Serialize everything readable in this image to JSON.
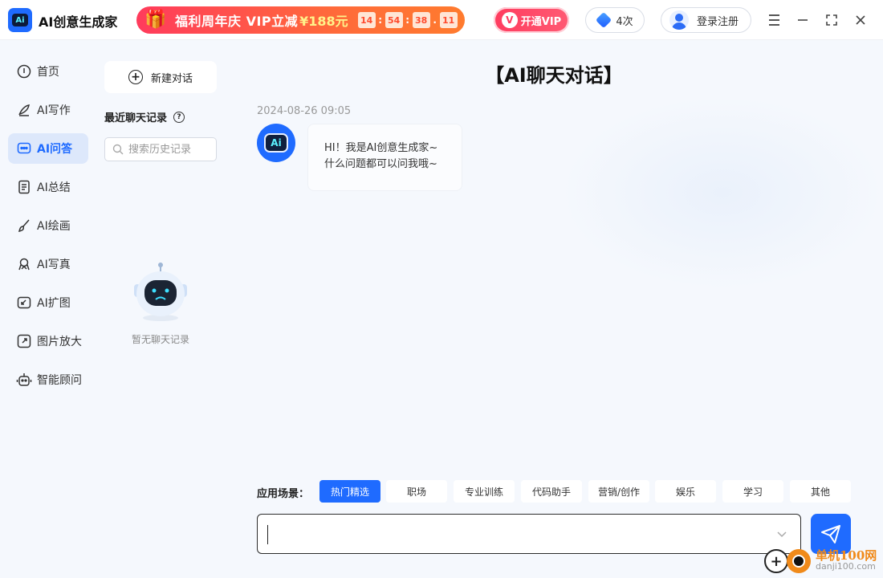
{
  "app": {
    "name": "AI创意生成家",
    "logo_text": "Ai"
  },
  "promo": {
    "text": "福利周年庆  VIP立减",
    "price": "¥188元",
    "countdown": [
      "14",
      "54",
      "38",
      "11"
    ]
  },
  "header": {
    "vip_label": "开通VIP",
    "count_label": "4次",
    "login_label": "登录注册"
  },
  "nav": {
    "items": [
      {
        "label": "首页",
        "icon": "home-icon"
      },
      {
        "label": "AI写作",
        "icon": "pen-icon"
      },
      {
        "label": "AI问答",
        "icon": "chat-icon"
      },
      {
        "label": "AI总结",
        "icon": "document-icon"
      },
      {
        "label": "AI绘画",
        "icon": "brush-icon"
      },
      {
        "label": "AI写真",
        "icon": "portrait-icon"
      },
      {
        "label": "AI扩图",
        "icon": "expand-image-icon"
      },
      {
        "label": "图片放大",
        "icon": "zoom-image-icon"
      },
      {
        "label": "智能顾问",
        "icon": "robot-icon"
      }
    ],
    "active_index": 2
  },
  "history": {
    "new_chat_label": "新建对话",
    "recent_title": "最近聊天记录",
    "search_placeholder": "搜索历史记录",
    "empty_text": "暂无聊天记录"
  },
  "chat": {
    "title": "【AI聊天对话】",
    "timestamp": "2024-08-26 09:05",
    "bot_avatar_text": "Ai",
    "message_line1": "HI！我是AI创意生成家~",
    "message_line2": "什么问题都可以问我哦~"
  },
  "scenes": {
    "label": "应用场景：",
    "tabs": [
      "热门精选",
      "职场",
      "专业训练",
      "代码助手",
      "营销/创作",
      "娱乐",
      "学习",
      "其他"
    ],
    "active_index": 0
  },
  "input": {
    "value": "",
    "placeholder": ""
  },
  "watermark": {
    "cn": "单机100网",
    "en": "danji100.com"
  },
  "colors": {
    "accent": "#1f6bff",
    "promo": "#ff4a3d",
    "vip": "#ff3c5f",
    "background": "#f5f8fd"
  }
}
